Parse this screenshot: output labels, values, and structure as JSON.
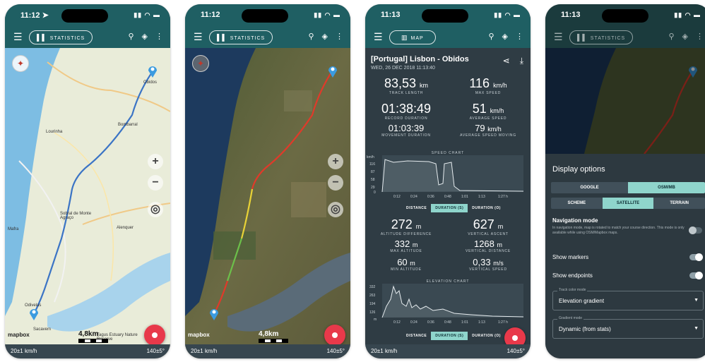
{
  "phone1": {
    "status_time": "11:12 ➤",
    "pill_label": "STATISTICS",
    "speed": "20±1 km/h",
    "bearing": "140±5°",
    "scale": "4,8km",
    "attribution": "mapbox",
    "places": [
      "Obidos",
      "Lourinha",
      "Bombarral",
      "Mafra",
      "Sobral de Monte Agraço",
      "Alenquer",
      "Odivelas",
      "Sacavem",
      "Tagus Estuary Nature Reserve"
    ]
  },
  "phone2": {
    "status_time": "11:12",
    "pill_label": "STATISTICS",
    "speed": "20±1 km/h",
    "bearing": "140±5°",
    "scale": "4,8km",
    "attribution": "mapbox"
  },
  "phone3": {
    "status_time": "11:13",
    "pill_label": "MAP",
    "route_title": "[Portugal] Lisbon - Obidos",
    "route_date": "WED, 26 DEC 2018 11:13:40",
    "track_length": {
      "value": "83,53",
      "unit": "km",
      "label": "TRACK LENGTH"
    },
    "max_speed": {
      "value": "116",
      "unit": "km/h",
      "label": "MAX SPEED"
    },
    "record_duration": {
      "value": "01:38:49",
      "label": "RECORD DURATION"
    },
    "avg_speed": {
      "value": "51",
      "unit": "km/h",
      "label": "AVERAGE SPEED"
    },
    "movement_duration": {
      "value": "01:03:39",
      "label": "MOVEMENT DURATION"
    },
    "avg_speed_moving": {
      "value": "79",
      "unit": "km/h",
      "label": "AVERAGE SPEED MOVING"
    },
    "speed_chart_title": "SPEED CHART",
    "speed_y_ticks": [
      "km/h",
      "116",
      "87",
      "58",
      "29",
      "0"
    ],
    "speed_x_ticks": [
      "0:12",
      "0:24",
      "0:36",
      "0:48",
      "1:01",
      "1:13",
      "1:27 h"
    ],
    "tabs": [
      "DISTANCE",
      "DURATION (S)",
      "DURATION (O)"
    ],
    "altitude_difference": {
      "value": "272",
      "unit": "m",
      "label": "ALTITUDE DIFFERENCE"
    },
    "vertical_ascent": {
      "value": "627",
      "unit": "m",
      "label": "VERTICAL ASCENT"
    },
    "max_altitude": {
      "value": "332",
      "unit": "m",
      "label": "MAX ALTITUDE"
    },
    "vertical_distance": {
      "value": "1268",
      "unit": "m",
      "label": "VERTICAL DISTANCE"
    },
    "min_altitude": {
      "value": "60",
      "unit": "m",
      "label": "MIN ALTITUDE"
    },
    "vertical_speed": {
      "value": "0,33",
      "unit": "m/s",
      "label": "VERTICAL SPEED"
    },
    "elevation_chart_title": "ELEVATION CHART",
    "elev_y_ticks": [
      "332",
      "263",
      "194",
      "126",
      "m"
    ],
    "elev_x_ticks": [
      "0:12",
      "0:24",
      "0:36",
      "0:48",
      "1:01",
      "1:13",
      "1:27 h"
    ],
    "speed": "20±1 km/h",
    "bearing": "140±5°"
  },
  "phone4": {
    "status_time": "11:13",
    "pill_label": "STATISTICS",
    "heading": "Display options",
    "provider_options": [
      "GOOGLE",
      "OSM/MB"
    ],
    "type_options": [
      "SCHEME",
      "SATELLITE",
      "TERRAIN"
    ],
    "nav_mode_title": "Navigation mode",
    "nav_mode_desc": "In navigation mode, map is rotated to match your course direction. This mode is only available while using OSM/Mapbox maps.",
    "show_markers": "Show markers",
    "show_endpoints": "Show endpoints",
    "track_color_label": "Track color mode",
    "track_color_value": "Elevation gradient",
    "gradient_label": "Gradient mode",
    "gradient_value": "Dynamic (from stats)"
  },
  "colors": {
    "bar": "#1f5f63",
    "accent": "#8fd5cc",
    "record": "#e8394a"
  }
}
